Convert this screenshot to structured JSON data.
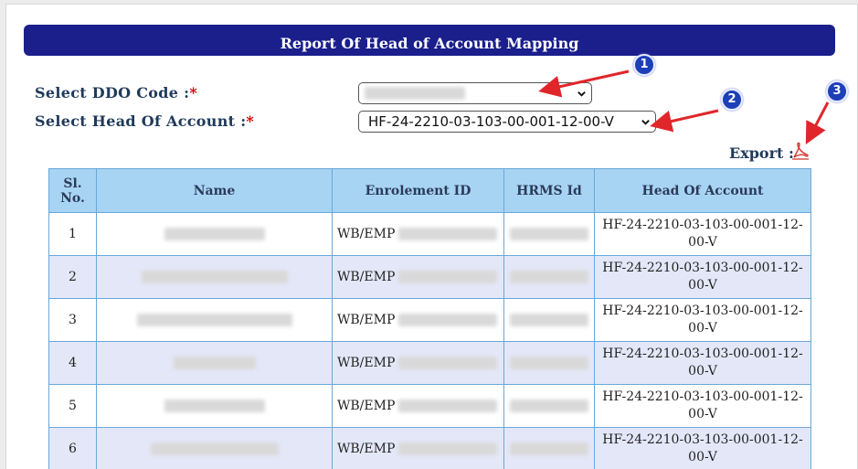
{
  "title": "Report Of Head of Account Mapping",
  "form": {
    "ddo_label": "Select DDO Code :",
    "hoa_label": "Select Head Of Account :",
    "required_mark": "*",
    "hoa_value": "HF-24-2210-03-103-00-001-12-00-V"
  },
  "export": {
    "label": "Export :",
    "icon": "pdf-icon"
  },
  "badges": [
    "1",
    "2",
    "3"
  ],
  "colors": {
    "title_bg": "#1a1f8c",
    "header_bg": "#a8d4f4",
    "alt_row": "#e4e7f8",
    "badge": "#1d3fb8",
    "arrow": "#e0262b"
  },
  "table": {
    "headers": [
      "Sl. No.",
      "Name",
      "Enrolement ID",
      "HRMS Id",
      "Head Of Account"
    ],
    "rows": [
      {
        "sl": "1",
        "enrolment_prefix": "WB/EMP",
        "hoa_line1": "HF-24-2210-03-103-00-001-12-",
        "hoa_line2": "00-V"
      },
      {
        "sl": "2",
        "enrolment_prefix": "WB/EMP",
        "hoa_line1": "HF-24-2210-03-103-00-001-12-",
        "hoa_line2": "00-V"
      },
      {
        "sl": "3",
        "enrolment_prefix": "WB/EMP",
        "hoa_line1": "HF-24-2210-03-103-00-001-12-",
        "hoa_line2": "00-V"
      },
      {
        "sl": "4",
        "enrolment_prefix": "WB/EMP",
        "hoa_line1": "HF-24-2210-03-103-00-001-12-",
        "hoa_line2": "00-V"
      },
      {
        "sl": "5",
        "enrolment_prefix": "WB/EMP",
        "hoa_line1": "HF-24-2210-03-103-00-001-12-",
        "hoa_line2": "00-V"
      },
      {
        "sl": "6",
        "enrolment_prefix": "WB/EMP",
        "hoa_line1": "HF-24-2210-03-103-00-001-12-",
        "hoa_line2": "00-V"
      }
    ]
  }
}
